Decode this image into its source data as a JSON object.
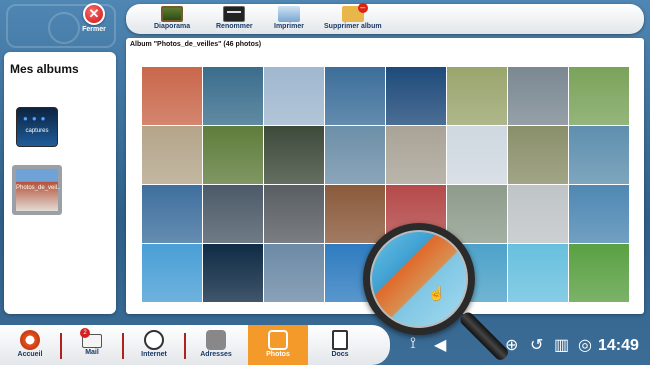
{
  "window": {
    "close_label": "Fermer"
  },
  "toolbar": {
    "items": [
      {
        "label": "Diaporama",
        "icon": "slideshow-icon"
      },
      {
        "label": "Renommer",
        "icon": "rename-icon"
      },
      {
        "label": "Imprimer",
        "icon": "printer-icon"
      },
      {
        "label": "Supprimer album",
        "icon": "delete-album-icon"
      }
    ]
  },
  "sidebar": {
    "title": "Mes albums",
    "albums": [
      {
        "label": "captures"
      },
      {
        "label": "Photos_de_veil.."
      }
    ]
  },
  "main": {
    "title": "Album \"Photos_de_veilles\" (46 photos)",
    "photo_colors": [
      [
        "#c9674b",
        "#3a6d8c",
        "#9fb7cf",
        "#3c6e9a",
        "#1e4a7a",
        "#9aa56d",
        "#7b8892",
        "#7aa35a"
      ],
      [
        "#b4a58a",
        "#5f7d3c",
        "#3d4a3a",
        "#6d8fa8",
        "#a9a397",
        "#cfd8e0",
        "#8a8f6a",
        "#5e8fae"
      ],
      [
        "#3f6f9e",
        "#4c5a68",
        "#595e63",
        "#8b5a3c",
        "#b54a4a",
        "#8e9c8c",
        "#bfc4c6",
        "#4e88b3"
      ],
      [
        "#4a9fd6",
        "#0f2b45",
        "#6c8aa6",
        "#2f7cc0",
        "#e27531",
        "#4da2c9",
        "#68c0de",
        "#5aa043"
      ]
    ]
  },
  "taskbar": {
    "items": [
      {
        "label": "Accueil",
        "icon": "home-icon"
      },
      {
        "label": "Mail",
        "icon": "mail-icon",
        "badge": "2"
      },
      {
        "label": "Internet",
        "icon": "globe-icon"
      },
      {
        "label": "Adresses",
        "icon": "contacts-icon"
      },
      {
        "label": "Photos",
        "icon": "camera-icon",
        "active": true
      },
      {
        "label": "Docs",
        "icon": "documents-icon"
      }
    ]
  },
  "tray": {
    "time": "14:49",
    "icons": [
      "wifi-icon",
      "volume-icon",
      "battery-icon",
      "add-icon",
      "back-icon",
      "trash-icon",
      "help-icon"
    ]
  },
  "colors": {
    "accent": "#f39a2b",
    "background": "#3d6f99"
  }
}
